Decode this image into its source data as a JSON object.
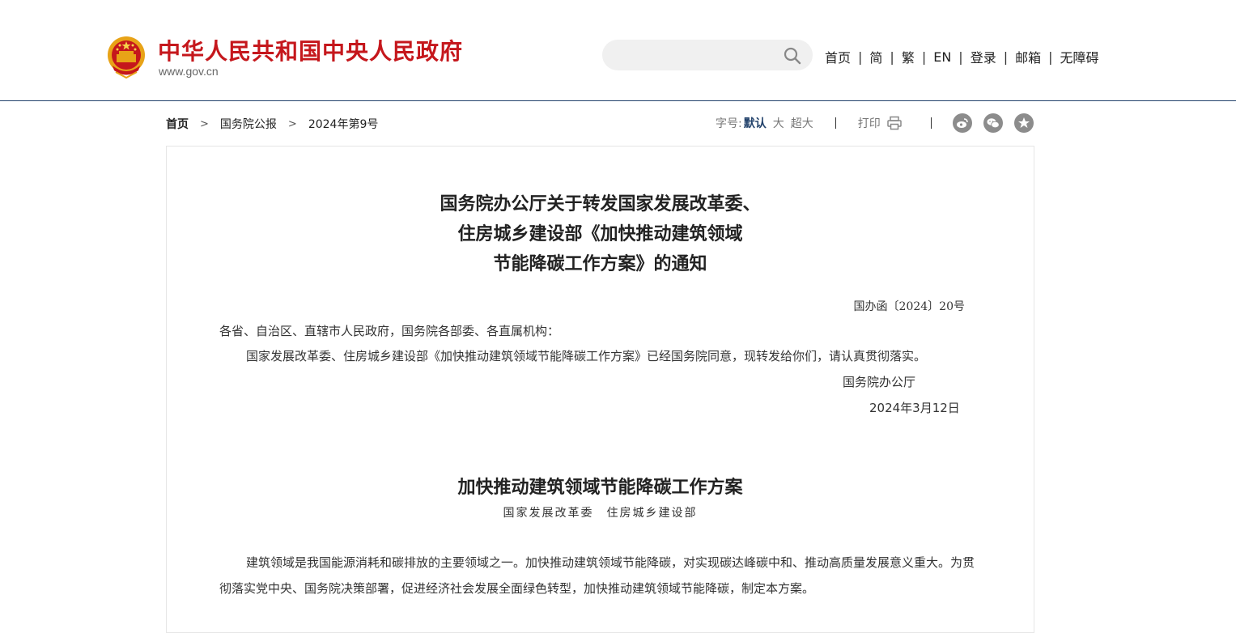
{
  "header": {
    "site_title": "中华人民共和国中央人民政府",
    "site_domain": "www.gov.cn",
    "search": {
      "placeholder": ""
    },
    "nav": [
      {
        "label": "首页"
      },
      {
        "label": "简"
      },
      {
        "label": "繁"
      },
      {
        "label": "EN"
      },
      {
        "label": "登录"
      },
      {
        "label": "邮箱"
      },
      {
        "label": "无障碍"
      }
    ],
    "nav_separator": "|"
  },
  "breadcrumb": {
    "items": [
      {
        "label": "首页"
      },
      {
        "label": "国务院公报"
      },
      {
        "label": "2024年第9号"
      }
    ]
  },
  "toolbar": {
    "font_size_label": "字号:",
    "font_default": "默认",
    "font_large": "大",
    "font_xlarge": "超大",
    "print_label": "打印",
    "share_icons": [
      "weibo-icon",
      "wechat-icon",
      "favorite-icon"
    ]
  },
  "article": {
    "title_lines": [
      "国务院办公厅关于转发国家发展改革委、",
      "住房城乡建设部《加快推动建筑领域",
      "节能降碳工作方案》的通知"
    ],
    "doc_number": "国办函〔2024〕20号",
    "addressee": "各省、自治区、直辖市人民政府，国务院各部委、各直属机构：",
    "body_1": "国家发展改革委、住房城乡建设部《加快推动建筑领域节能降碳工作方案》已经国务院同意，现转发给你们，请认真贯彻落实。",
    "signature_office": "国务院办公厅",
    "signature_date": "2024年3月12日",
    "plan_title": "加快推动建筑领域节能降碳工作方案",
    "plan_subtitle": "国家发展改革委　住房城乡建设部",
    "intro": "建筑领域是我国能源消耗和碳排放的主要领域之一。加快推动建筑领域节能降碳，对实现碳达峰碳中和、推动高质量发展意义重大。为贯彻落实党中央、国务院决策部署，促进经济社会发展全面绿色转型，加快推动建筑领域节能降碳，制定本方案。"
  },
  "colors": {
    "brand_red": "#c5171c",
    "header_rule": "#22426b",
    "font_active": "#22426b",
    "share_icon_bg": "#8c8c8c",
    "search_bg": "#f0f0f0"
  }
}
